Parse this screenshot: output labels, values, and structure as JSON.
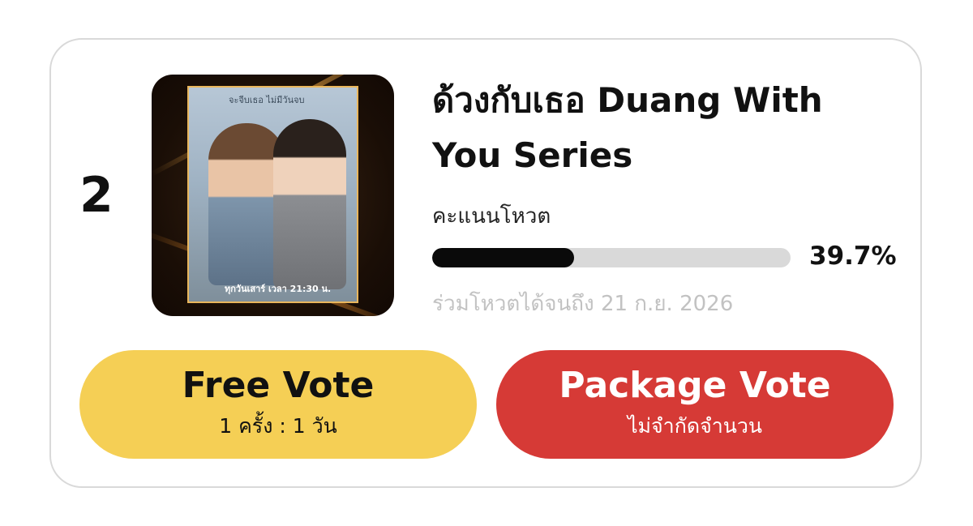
{
  "entry": {
    "rank": "2",
    "poster": {
      "tagline": "จะจีบเธอ ไม่มีวันจบ",
      "air_info": "ทุกวันเสาร์ เวลา 21:30 น."
    },
    "title": "ด้วงกับเธอ Duang With You Series",
    "vote_label": "คะแนนโหวต",
    "progress_percent": 39.7,
    "percent_text": "39.7%",
    "deadline": "ร่วมโหวตได้จนถึง 21 ก.ย. 2026"
  },
  "buttons": {
    "free": {
      "label": "Free Vote",
      "sub": "1 ครั้ง : 1 วัน"
    },
    "package": {
      "label": "Package Vote",
      "sub": "ไม่จำกัดจำนวน"
    }
  },
  "colors": {
    "free_button": "#f5cf55",
    "package_button": "#d63a36",
    "progress_fill": "#0a0a0a",
    "progress_track": "#d9d9d9",
    "deadline_text": "#c2c2c2"
  }
}
